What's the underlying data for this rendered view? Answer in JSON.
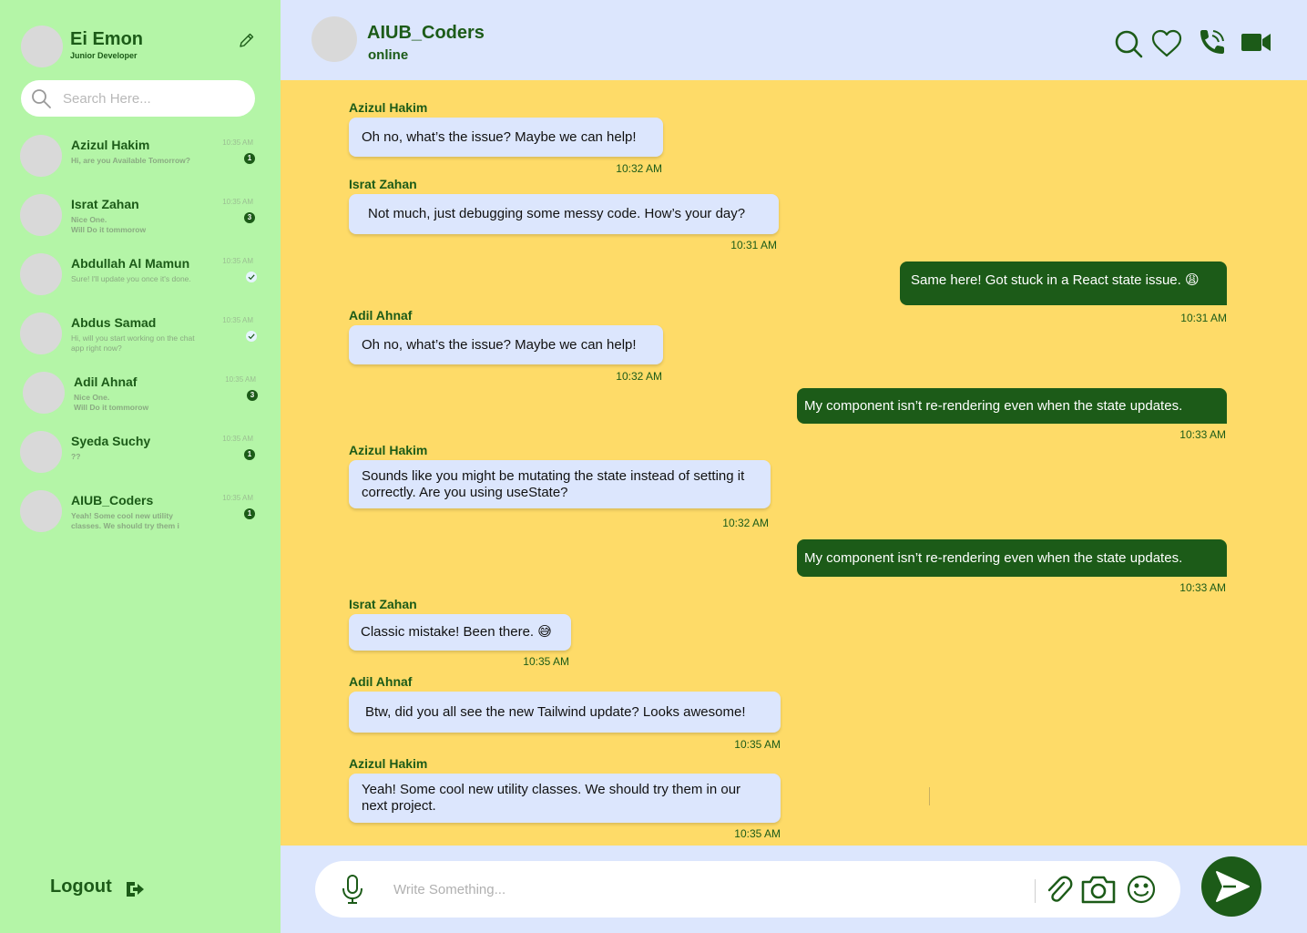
{
  "colors": {
    "brand": "#1c5b18",
    "sidebar_bg": "#b4f5a7",
    "header_bg": "#dce6fd",
    "chat_bg": "#fedb68",
    "bubble_in": "#dce6fd"
  },
  "profile": {
    "name": "Ei Emon",
    "role": "Junior Developer"
  },
  "search": {
    "placeholder": "Search Here..."
  },
  "chats": [
    {
      "name": "Azizul Hakim",
      "preview": "Hi, are you Available Tomorrow?",
      "time": "10:35 AM",
      "badge": "1"
    },
    {
      "name": "Israt Zahan",
      "preview": "Nice One.\nWill Do it tommorow",
      "time": "10:35 AM",
      "badge": "3"
    },
    {
      "name": "Abdullah Al Mamun",
      "preview": "Sure! I'll update you once it's done.",
      "time": "10:35 AM",
      "status": "read-check-icon"
    },
    {
      "name": "Abdus Samad",
      "preview": "Hi, will you start working on the chat app right now?",
      "time": "10:35 AM",
      "status": "read-check-icon"
    },
    {
      "name": "Adil Ahnaf",
      "preview": "Nice One.\nWill Do it tommorow",
      "time": "10:35 AM",
      "badge": "3"
    },
    {
      "name": "Syeda Suchy",
      "preview": "??",
      "time": "10:35 AM",
      "badge": "1"
    },
    {
      "name": "AIUB_Coders",
      "preview": "Yeah! Some cool new utility classes. We should try them i",
      "time": "10:35 AM",
      "badge": "1"
    }
  ],
  "logout": {
    "label": "Logout"
  },
  "header": {
    "title": "AIUB_Coders",
    "status": "online",
    "icons": [
      "search-icon",
      "heart-icon",
      "phone-icon",
      "video-camera-icon"
    ]
  },
  "messages": [
    {
      "sender": "Azizul Hakim",
      "text": "Oh no, what’s the issue? Maybe we can help!",
      "time": "10:32 AM"
    },
    {
      "sender": "Israt Zahan",
      "text": "Not much, just debugging some messy code. How’s your day?",
      "time": "10:31 AM"
    },
    {
      "sender": "",
      "text": "Same here! Got stuck in a React state issue. 😩",
      "time": "10:31 AM"
    },
    {
      "sender": "Adil Ahnaf",
      "text": "Oh no, what’s the issue? Maybe we can help!",
      "time": "10:32 AM"
    },
    {
      "sender": "",
      "text": "My component isn’t re-rendering even when the state updates.",
      "time": "10:33 AM"
    },
    {
      "sender": "Azizul Hakim",
      "text": "Sounds like you might be mutating the state instead of setting it correctly. Are you using useState?",
      "time": "10:32 AM"
    },
    {
      "sender": "",
      "text": "My component isn’t re-rendering even when the state updates.",
      "time": "10:33 AM"
    },
    {
      "sender": "Israt Zahan",
      "text": "Classic mistake! Been there. 😅",
      "time": "10:35 AM"
    },
    {
      "sender": "Adil Ahnaf",
      "text": "Btw, did you all see the new Tailwind update? Looks awesome!",
      "time": "10:35 AM"
    },
    {
      "sender": "Azizul Hakim",
      "text": "Yeah! Some cool new utility classes. We should try them in our next project.",
      "time": "10:35 AM"
    }
  ],
  "composer": {
    "placeholder": "Write Something...",
    "icons": [
      "microphone-icon",
      "paperclip-icon",
      "camera-icon",
      "emoji-icon",
      "send-icon"
    ]
  }
}
